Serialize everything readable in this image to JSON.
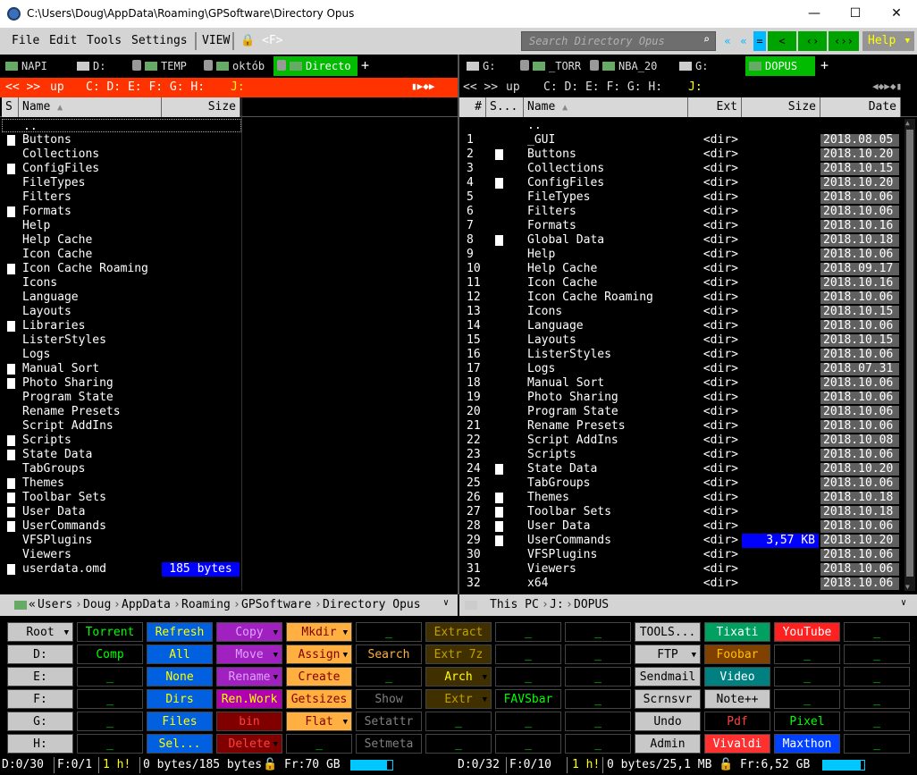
{
  "window": {
    "title": "C:\\Users\\Doug\\AppData\\Roaming\\GPSoftware\\Directory Opus",
    "min": "—",
    "max": "☐",
    "close": "✕"
  },
  "menu": {
    "items": [
      "File",
      "Edit",
      "Tools",
      "Settings"
    ],
    "view": "VIEW",
    "filter": "<F>",
    "search_placeholder": "Search Directory Opus",
    "toolbar": [
      "«",
      "«",
      "=",
      "<",
      "‹›",
      "‹››"
    ],
    "help": "Help"
  },
  "left_tabs": [
    "NAPI",
    "D:",
    "TEMP",
    "októb",
    "Directo"
  ],
  "right_tabs": [
    "G:",
    "_TORR",
    "NBA_20",
    "G:",
    "DOPUS"
  ],
  "plus": "+",
  "left_loc": {
    "nav": "<<  >>",
    "up": "up",
    "drives": "C: D: E: F: G: H:",
    "j": "J:"
  },
  "right_loc": {
    "nav": "<<  >>",
    "up": "up",
    "drives": "C: D: E: F: G: H:",
    "j": "J:"
  },
  "left_headers": {
    "s": "S",
    "name": "Name",
    "size": "Size"
  },
  "right_headers": {
    "num": "#",
    "s": "S...",
    "name": "Name",
    "ext": "Ext",
    "size": "Size",
    "date": "Date"
  },
  "left_files": [
    {
      "n": "..",
      "d": false
    },
    {
      "n": "Buttons",
      "d": true
    },
    {
      "n": "Collections",
      "d": false
    },
    {
      "n": "ConfigFiles",
      "d": true
    },
    {
      "n": "FileTypes",
      "d": false
    },
    {
      "n": "Filters",
      "d": false
    },
    {
      "n": "Formats",
      "d": true
    },
    {
      "n": "Help",
      "d": false
    },
    {
      "n": "Help Cache",
      "d": false
    },
    {
      "n": "Icon Cache",
      "d": false
    },
    {
      "n": "Icon Cache Roaming",
      "d": true
    },
    {
      "n": "Icons",
      "d": false
    },
    {
      "n": "Language",
      "d": false
    },
    {
      "n": "Layouts",
      "d": false
    },
    {
      "n": "Libraries",
      "d": true
    },
    {
      "n": "ListerStyles",
      "d": false
    },
    {
      "n": "Logs",
      "d": false
    },
    {
      "n": "Manual Sort",
      "d": true
    },
    {
      "n": "Photo Sharing",
      "d": true
    },
    {
      "n": "Program State",
      "d": false
    },
    {
      "n": "Rename Presets",
      "d": false
    },
    {
      "n": "Script AddIns",
      "d": false
    },
    {
      "n": "Scripts",
      "d": true
    },
    {
      "n": "State Data",
      "d": true
    },
    {
      "n": "TabGroups",
      "d": false
    },
    {
      "n": "Themes",
      "d": true
    },
    {
      "n": "Toolbar Sets",
      "d": true
    },
    {
      "n": "User Data",
      "d": true
    },
    {
      "n": "UserCommands",
      "d": true
    },
    {
      "n": "VFSPlugins",
      "d": false
    },
    {
      "n": "Viewers",
      "d": false
    },
    {
      "n": "userdata.omd",
      "d": true,
      "size": "185 bytes"
    }
  ],
  "right_files": [
    {
      "num": "",
      "n": "..",
      "d": false,
      "ext": "",
      "date": ""
    },
    {
      "num": "1",
      "n": "_GUI",
      "d": false,
      "ext": "<dir>",
      "date": "2018.08.05"
    },
    {
      "num": "2",
      "n": "Buttons",
      "d": true,
      "ext": "<dir>",
      "date": "2018.10.20"
    },
    {
      "num": "3",
      "n": "Collections",
      "d": false,
      "ext": "<dir>",
      "date": "2018.10.15"
    },
    {
      "num": "4",
      "n": "ConfigFiles",
      "d": true,
      "ext": "<dir>",
      "date": "2018.10.20"
    },
    {
      "num": "5",
      "n": "FileTypes",
      "d": false,
      "ext": "<dir>",
      "date": "2018.10.06"
    },
    {
      "num": "6",
      "n": "Filters",
      "d": false,
      "ext": "<dir>",
      "date": "2018.10.06"
    },
    {
      "num": "7",
      "n": "Formats",
      "d": false,
      "ext": "<dir>",
      "date": "2018.10.16"
    },
    {
      "num": "8",
      "n": "Global Data",
      "d": true,
      "ext": "<dir>",
      "date": "2018.10.18"
    },
    {
      "num": "9",
      "n": "Help",
      "d": false,
      "ext": "<dir>",
      "date": "2018.10.06"
    },
    {
      "num": "10",
      "n": "Help Cache",
      "d": false,
      "ext": "<dir>",
      "date": "2018.09.17"
    },
    {
      "num": "11",
      "n": "Icon Cache",
      "d": false,
      "ext": "<dir>",
      "date": "2018.10.16"
    },
    {
      "num": "12",
      "n": "Icon Cache Roaming",
      "d": false,
      "ext": "<dir>",
      "date": "2018.10.06"
    },
    {
      "num": "13",
      "n": "Icons",
      "d": false,
      "ext": "<dir>",
      "date": "2018.10.15"
    },
    {
      "num": "14",
      "n": "Language",
      "d": false,
      "ext": "<dir>",
      "date": "2018.10.06"
    },
    {
      "num": "15",
      "n": "Layouts",
      "d": false,
      "ext": "<dir>",
      "date": "2018.10.15"
    },
    {
      "num": "16",
      "n": "ListerStyles",
      "d": false,
      "ext": "<dir>",
      "date": "2018.10.06"
    },
    {
      "num": "17",
      "n": "Logs",
      "d": false,
      "ext": "<dir>",
      "date": "2018.07.31"
    },
    {
      "num": "18",
      "n": "Manual Sort",
      "d": false,
      "ext": "<dir>",
      "date": "2018.10.06"
    },
    {
      "num": "19",
      "n": "Photo Sharing",
      "d": false,
      "ext": "<dir>",
      "date": "2018.10.06"
    },
    {
      "num": "20",
      "n": "Program State",
      "d": false,
      "ext": "<dir>",
      "date": "2018.10.06"
    },
    {
      "num": "21",
      "n": "Rename Presets",
      "d": false,
      "ext": "<dir>",
      "date": "2018.10.06"
    },
    {
      "num": "22",
      "n": "Script AddIns",
      "d": false,
      "ext": "<dir>",
      "date": "2018.10.08"
    },
    {
      "num": "23",
      "n": "Scripts",
      "d": false,
      "ext": "<dir>",
      "date": "2018.10.06"
    },
    {
      "num": "24",
      "n": "State Data",
      "d": true,
      "ext": "<dir>",
      "date": "2018.10.20"
    },
    {
      "num": "25",
      "n": "TabGroups",
      "d": false,
      "ext": "<dir>",
      "date": "2018.10.06"
    },
    {
      "num": "26",
      "n": "Themes",
      "d": true,
      "ext": "<dir>",
      "date": "2018.10.18"
    },
    {
      "num": "27",
      "n": "Toolbar Sets",
      "d": true,
      "ext": "<dir>",
      "date": "2018.10.18"
    },
    {
      "num": "28",
      "n": "User Data",
      "d": true,
      "ext": "<dir>",
      "date": "2018.10.06"
    },
    {
      "num": "29",
      "n": "UserCommands",
      "d": true,
      "ext": "<dir>",
      "date": "2018.10.20",
      "size": "3,57 KB"
    },
    {
      "num": "30",
      "n": "VFSPlugins",
      "d": false,
      "ext": "<dir>",
      "date": "2018.10.06"
    },
    {
      "num": "31",
      "n": "Viewers",
      "d": false,
      "ext": "<dir>",
      "date": "2018.10.06"
    },
    {
      "num": "32",
      "n": "x64",
      "d": false,
      "ext": "<dir>",
      "date": "2018.10.06"
    }
  ],
  "left_path": [
    "«",
    "Users",
    "Doug",
    "AppData",
    "Roaming",
    "GPSoftware",
    "Directory Opus"
  ],
  "right_path": [
    "This PC",
    "J:",
    "DOPUS"
  ],
  "buttons": [
    [
      "Root",
      "Torrent",
      "Refresh",
      "Copy",
      "Mkdir",
      "_",
      "Extract",
      "_",
      "_",
      "TOOLS...",
      "Tixati",
      "YouTube",
      "_"
    ],
    [
      "D:",
      "Comp",
      "All",
      "Move",
      "Assign",
      "Search",
      "Extr 7z",
      "_",
      "_",
      "FTP",
      "Foobar",
      "_",
      "_"
    ],
    [
      "E:",
      "_",
      "None",
      "Rename",
      "Create",
      "_",
      "Arch",
      "_",
      "_",
      "Sendmail",
      "Video",
      "_",
      "_"
    ],
    [
      "F:",
      "_",
      "Dirs",
      "Ren.Work",
      "Getsizes",
      "Show",
      "Extr",
      "FAVSbar",
      "_",
      "Scrnsvr",
      "Note++",
      "_",
      "_"
    ],
    [
      "G:",
      "_",
      "Files",
      "bin",
      "Flat",
      "Setattr",
      "_",
      "_",
      "_",
      "Undo",
      "Pdf",
      "Pixel",
      "_"
    ],
    [
      "H:",
      "_",
      "Sel...",
      "Delete",
      "_",
      "Setmeta",
      "_",
      "_",
      "_",
      "Admin",
      "Vivaldi",
      "Maxthon",
      "_"
    ]
  ],
  "colors": {
    "accent_red": "#ff3300",
    "tab_green": "#00bb00",
    "selection_blue": "#0000ff"
  },
  "status_left": {
    "d": "D:0/30",
    "f": "F:0/1",
    "h": "1 h!",
    "bytes": "0 bytes/185 bytes",
    "fr": "Fr:70 GB",
    "free_fraction": 0.88
  },
  "status_right": {
    "d": "D:0/32",
    "f": "F:0/10",
    "h": "1 h!",
    "bytes": "0 bytes/25,1 MB",
    "fr": "Fr:6,52 GB",
    "free_fraction": 0.92
  }
}
